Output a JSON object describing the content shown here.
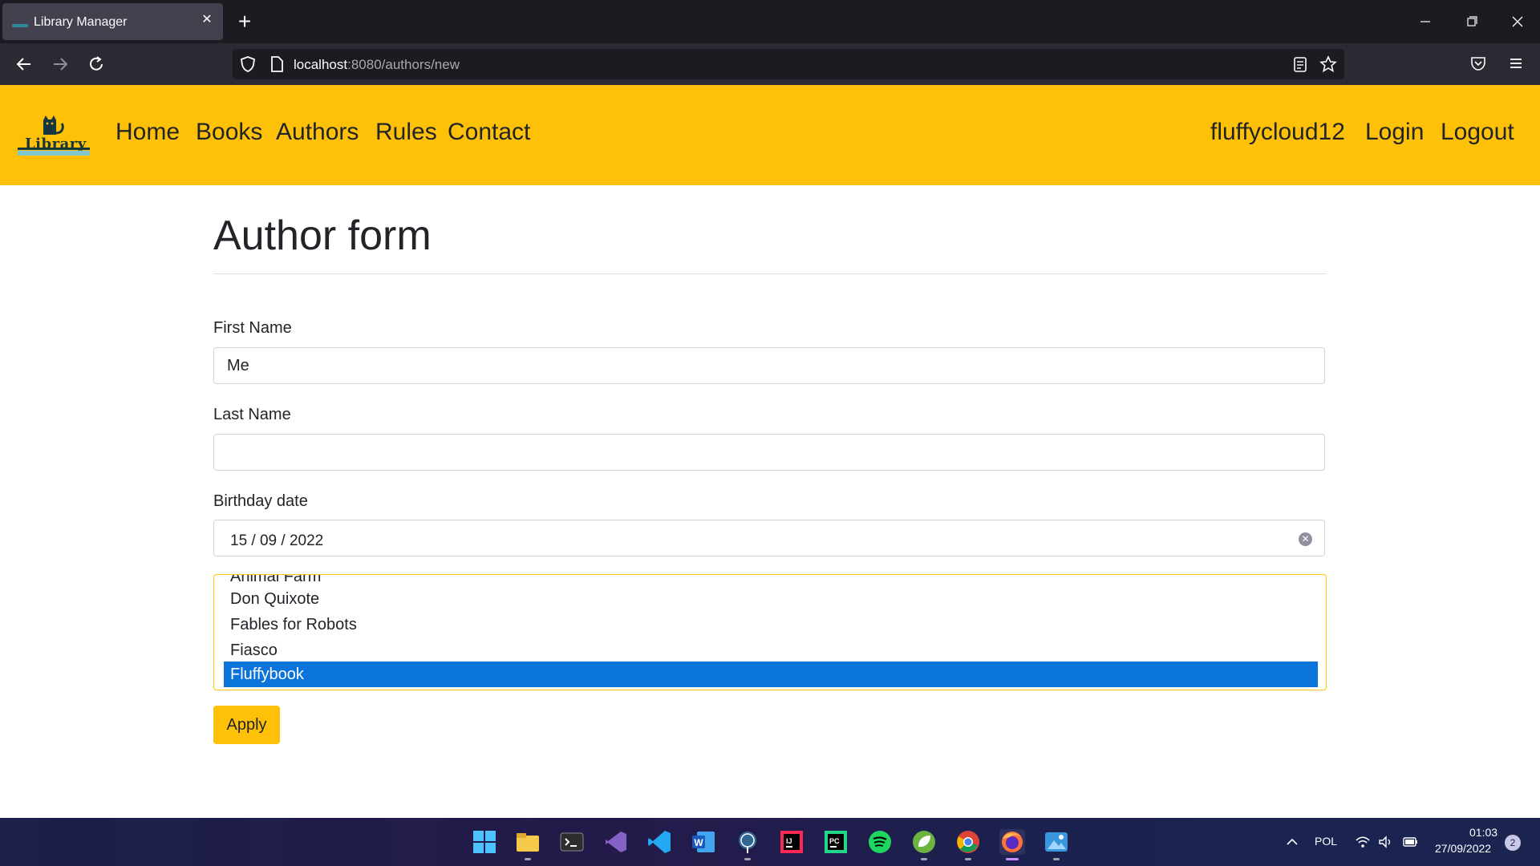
{
  "browser": {
    "tab_title": "Library Manager",
    "url_host": "localhost",
    "url_path": ":8080/authors/new"
  },
  "site": {
    "logo_text": "Library",
    "nav": [
      "Home",
      "Books",
      "Authors",
      "Rules",
      "Contact"
    ],
    "user_nav": [
      "fluffycloud12",
      "Login",
      "Logout"
    ],
    "accent_color": "#ffc107"
  },
  "form": {
    "title": "Author form",
    "first_name_label": "First Name",
    "first_name_value": "Me",
    "last_name_label": "Last Name",
    "last_name_value": "",
    "birthday_label": "Birthday date",
    "birthday_value": "15 / 09 / 2022",
    "books_options": [
      "Animal Farm",
      "Don Quixote",
      "Fables for Robots",
      "Fiasco",
      "Fluffybook"
    ],
    "books_selected": "Fluffybook",
    "apply_label": "Apply"
  },
  "taskbar": {
    "language": "POL",
    "time": "01:03",
    "date": "27/09/2022",
    "notification_count": "2",
    "apps": [
      "start-icon",
      "file-explorer-icon",
      "terminal-icon",
      "visual-studio-icon",
      "vscode-icon",
      "word-icon",
      "postgresql-icon",
      "intellij-icon",
      "pycharm-icon",
      "spotify-icon",
      "spring-icon",
      "chrome-icon",
      "firefox-icon",
      "photos-icon"
    ]
  }
}
